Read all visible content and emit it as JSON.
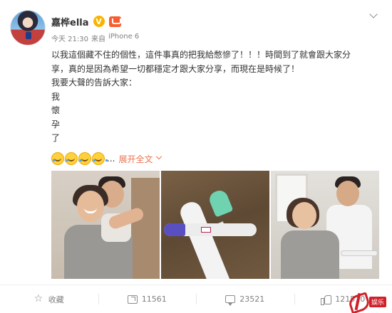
{
  "post": {
    "username": "嘉桦ella",
    "badge_glyph": "V",
    "time": "今天 21:30",
    "source_prefix": "来自",
    "source": "iPhone 6",
    "lines": [
      "以我這個藏不住的個性，這件事真的把我給憋慘了！！！時間到了就會跟大家分",
      "享，真的是因為希望一切都穩定才跟大家分享，而現在是時候了！",
      "我要大聲的告訴大家：",
      "我",
      "懷",
      "孕",
      "了"
    ],
    "emoji_names": [
      "laugh-cry-emoji",
      "laugh-cry-emoji",
      "laugh-cry-emoji",
      "laugh-cry-emoji"
    ],
    "ellipsis": "...",
    "expand_label": "展开全文",
    "photos": [
      {
        "name": "couple-hug-photo"
      },
      {
        "name": "pregnancy-test-photo"
      },
      {
        "name": "couple-test-photo"
      }
    ]
  },
  "footer": {
    "favorite_label": "收藏",
    "repost_count": "11561",
    "comment_count": "23521",
    "like_count": "121510"
  },
  "watermark": {
    "text": "娱乐",
    "color": "#d0202a"
  },
  "colors": {
    "link": "#eb7350",
    "meta": "#808080",
    "text": "#333333"
  }
}
